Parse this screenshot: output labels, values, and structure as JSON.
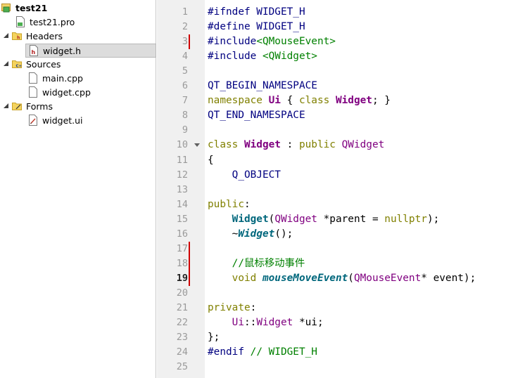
{
  "project": {
    "name": "test21",
    "pro_file": "test21.pro",
    "groups": [
      {
        "label": "Headers",
        "files": [
          "widget.h"
        ]
      },
      {
        "label": "Sources",
        "files": [
          "main.cpp",
          "widget.cpp"
        ]
      },
      {
        "label": "Forms",
        "files": [
          "widget.ui"
        ]
      }
    ],
    "selected_file": "widget.h"
  },
  "editor": {
    "current_line": 19,
    "fold_line": 10,
    "changed_lines": [
      3,
      17,
      18,
      19
    ],
    "lines": [
      {
        "n": "1",
        "tokens": [
          {
            "t": "#ifndef WIDGET_H",
            "c": "pp"
          }
        ]
      },
      {
        "n": "2",
        "tokens": [
          {
            "t": "#define WIDGET_H",
            "c": "pp"
          }
        ]
      },
      {
        "n": "3",
        "tokens": [
          {
            "t": "#include",
            "c": "pp"
          },
          {
            "t": "<QMouseEvent>",
            "c": "str"
          }
        ]
      },
      {
        "n": "4",
        "tokens": [
          {
            "t": "#include ",
            "c": "pp"
          },
          {
            "t": "<QWidget>",
            "c": "str"
          }
        ]
      },
      {
        "n": "5",
        "tokens": []
      },
      {
        "n": "6",
        "tokens": [
          {
            "t": "QT_BEGIN_NAMESPACE",
            "c": "macro"
          }
        ]
      },
      {
        "n": "7",
        "tokens": [
          {
            "t": "namespace ",
            "c": "kw"
          },
          {
            "t": "Ui",
            "c": "typeb"
          },
          {
            "t": " { ",
            "c": "plain"
          },
          {
            "t": "class ",
            "c": "kw"
          },
          {
            "t": "Widget",
            "c": "typeb"
          },
          {
            "t": "; }",
            "c": "plain"
          }
        ]
      },
      {
        "n": "8",
        "tokens": [
          {
            "t": "QT_END_NAMESPACE",
            "c": "macro"
          }
        ]
      },
      {
        "n": "9",
        "tokens": []
      },
      {
        "n": "10",
        "tokens": [
          {
            "t": "class ",
            "c": "kw"
          },
          {
            "t": "Widget",
            "c": "typeb"
          },
          {
            "t": " : ",
            "c": "plain"
          },
          {
            "t": "public ",
            "c": "kw"
          },
          {
            "t": "QWidget",
            "c": "type"
          }
        ]
      },
      {
        "n": "11",
        "tokens": [
          {
            "t": "{",
            "c": "plain"
          }
        ]
      },
      {
        "n": "12",
        "tokens": [
          {
            "t": "    Q_OBJECT",
            "c": "macro"
          }
        ]
      },
      {
        "n": "13",
        "tokens": []
      },
      {
        "n": "14",
        "tokens": [
          {
            "t": "public",
            "c": "kw"
          },
          {
            "t": ":",
            "c": "plain"
          }
        ]
      },
      {
        "n": "15",
        "tokens": [
          {
            "t": "    ",
            "c": "plain"
          },
          {
            "t": "Widget",
            "c": "fn"
          },
          {
            "t": "(",
            "c": "plain"
          },
          {
            "t": "QWidget",
            "c": "type"
          },
          {
            "t": " *parent = ",
            "c": "plain"
          },
          {
            "t": "nullptr",
            "c": "kw"
          },
          {
            "t": ");",
            "c": "plain"
          }
        ]
      },
      {
        "n": "16",
        "tokens": [
          {
            "t": "    ~",
            "c": "plain"
          },
          {
            "t": "Widget",
            "c": "fni"
          },
          {
            "t": "();",
            "c": "plain"
          }
        ]
      },
      {
        "n": "17",
        "tokens": []
      },
      {
        "n": "18",
        "tokens": [
          {
            "t": "    //鼠标移动事件",
            "c": "cm"
          }
        ]
      },
      {
        "n": "19",
        "tokens": [
          {
            "t": "    ",
            "c": "plain"
          },
          {
            "t": "void ",
            "c": "kw"
          },
          {
            "t": "mouseMoveEvent",
            "c": "fnv"
          },
          {
            "t": "(",
            "c": "plain"
          },
          {
            "t": "QMouseEvent",
            "c": "type"
          },
          {
            "t": "* event);",
            "c": "plain"
          }
        ]
      },
      {
        "n": "20",
        "tokens": []
      },
      {
        "n": "21",
        "tokens": [
          {
            "t": "private",
            "c": "kw"
          },
          {
            "t": ":",
            "c": "plain"
          }
        ]
      },
      {
        "n": "22",
        "tokens": [
          {
            "t": "    ",
            "c": "plain"
          },
          {
            "t": "Ui",
            "c": "type"
          },
          {
            "t": "::",
            "c": "plain"
          },
          {
            "t": "Widget",
            "c": "type"
          },
          {
            "t": " *ui;",
            "c": "plain"
          }
        ]
      },
      {
        "n": "23",
        "tokens": [
          {
            "t": "};",
            "c": "plain"
          }
        ]
      },
      {
        "n": "24",
        "tokens": [
          {
            "t": "#endif ",
            "c": "pp"
          },
          {
            "t": "// WIDGET_H",
            "c": "cm"
          }
        ]
      },
      {
        "n": "25",
        "tokens": []
      }
    ]
  },
  "icons": {
    "project": "qt-project-icon",
    "pro_file": "pro-file-icon",
    "headers_folder": "folder-headers-icon",
    "sources_folder": "folder-sources-icon",
    "forms_folder": "folder-forms-icon",
    "header_file": "header-file-icon",
    "cpp_file": "cpp-file-icon",
    "ui_file": "ui-file-icon"
  },
  "colors": {
    "preprocessor": "#000080",
    "keyword": "#808000",
    "type": "#800080",
    "string": "#008000",
    "comment": "#008000",
    "function": "#00677c",
    "change_marker": "#d00000"
  }
}
